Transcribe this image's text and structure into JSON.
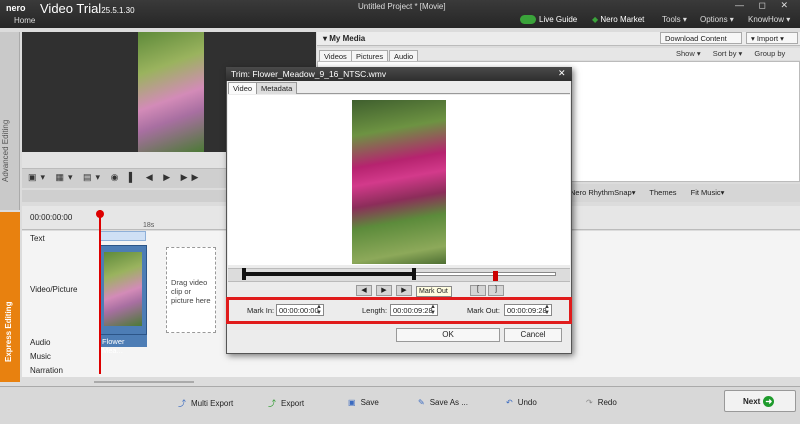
{
  "app": {
    "logo": "nero",
    "title": "Video",
    "edition": "Trial",
    "version": "25.5.1.30",
    "home": "Home",
    "project": "Untitled Project * [Movie]",
    "window_controls": "— ◻ ✕"
  },
  "topbar": {
    "live_guide": "Live Guide",
    "nero_market": "Nero Market",
    "tools": "Tools ▾",
    "options": "Options ▾",
    "knowhow": "KnowHow ▾"
  },
  "side_tabs": {
    "advanced": "Advanced Editing",
    "express": "Express Editing"
  },
  "media": {
    "title": "▾ My Media",
    "download": "Download Content",
    "import": "▾ Import ▾",
    "tabs": [
      "Videos",
      "Pictures",
      "Audio"
    ],
    "show": "Show ▾",
    "sort": "Sort by ▾",
    "group": "Group by ▾"
  },
  "toolbar2": {
    "rhythm": "Nero RhythmSnap▾",
    "themes": "Themes",
    "fit_music": "Fit Music▾"
  },
  "timeline": {
    "timecode": "00:00:00:00",
    "mark": "18s",
    "tracks": [
      "Text",
      "Video/Picture",
      "Audio",
      "Music",
      "Narration"
    ],
    "clip_label": "Flower Mea...",
    "drag_hint": "Drag video clip or picture here"
  },
  "dialog": {
    "title": "Trim:  Flower_Meadow_9_16_NTSC.wmv",
    "close": "✕",
    "tabs": [
      "Video",
      "Metadata"
    ],
    "mark_out_tip": "Mark Out",
    "mark_in_label": "Mark In:",
    "mark_in_value": "00:00:00:00",
    "length_label": "Length:",
    "length_value": "00:00:09:28",
    "mark_out_label": "Mark Out:",
    "mark_out_value": "00:00:09:28",
    "ok": "OK",
    "cancel": "Cancel"
  },
  "bottombar": {
    "multi_export": "Multi Export",
    "export": "Export",
    "save": "Save",
    "save_as": "Save As ...",
    "undo": "Undo",
    "redo": "Redo",
    "next": "Next"
  }
}
